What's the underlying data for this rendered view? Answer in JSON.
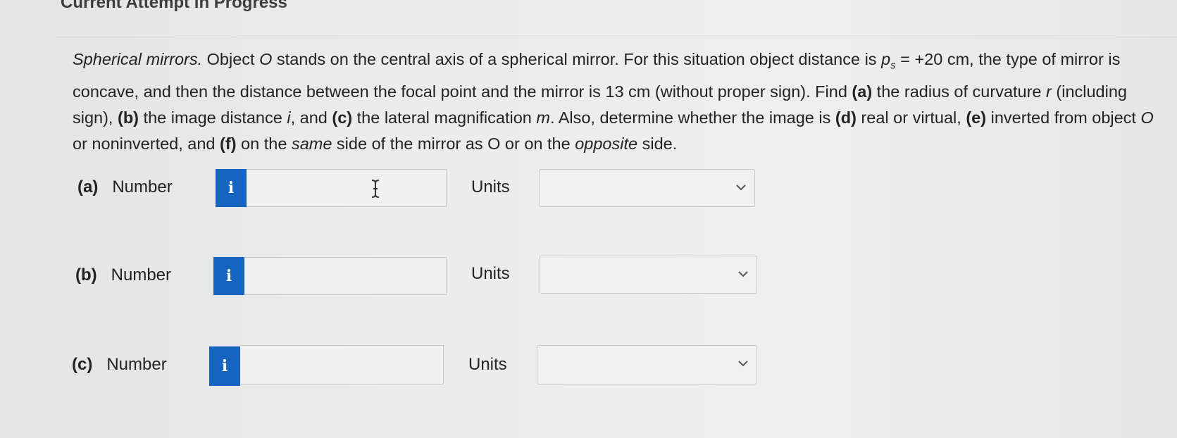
{
  "header": {
    "title": "Current Attempt in Progress"
  },
  "question": {
    "s1": "Spherical mirrors.",
    "s2": " Object ",
    "s3": "O",
    "s4": " stands on the central axis of a spherical mirror. For this situation object distance is ",
    "s5": "p",
    "s6": "s",
    "s7": " = +20 cm, the type of mirror is concave, and then the distance between the focal point and the mirror is 13 cm (without proper sign). Find ",
    "s8": "(a)",
    "s9": " the radius of curvature ",
    "s10": "r",
    "s11": " (including sign), ",
    "s12": "(b)",
    "s13": " the image distance ",
    "s14": "i",
    "s15": ", and ",
    "s16": "(c)",
    "s17": " the lateral magnification ",
    "s18": "m",
    "s19": ". Also, determine whether the image is ",
    "s20": "(d)",
    "s21": " real or virtual, ",
    "s22": "(e)",
    "s23": " inverted from object ",
    "s24": "O",
    "s25": " or noninverted, and ",
    "s26": "(f)",
    "s27": " on the ",
    "s28": "same",
    "s29": " side of the mirror as O or on the ",
    "s30": "opposite",
    "s31": " side."
  },
  "rows": [
    {
      "part": "(a)",
      "label": "Number",
      "info": "i",
      "value": "",
      "units_label": "Units",
      "units_value": ""
    },
    {
      "part": "(b)",
      "label": "Number",
      "info": "i",
      "value": "",
      "units_label": "Units",
      "units_value": ""
    },
    {
      "part": "(c)",
      "label": "Number",
      "info": "i",
      "value": "",
      "units_label": "Units",
      "units_value": ""
    }
  ],
  "colors": {
    "info_button": "#1565c0",
    "background": "#ececec"
  },
  "icons": {
    "info": "info-icon",
    "dropdown": "chevron-down-icon",
    "cursor": "text-cursor-icon"
  }
}
